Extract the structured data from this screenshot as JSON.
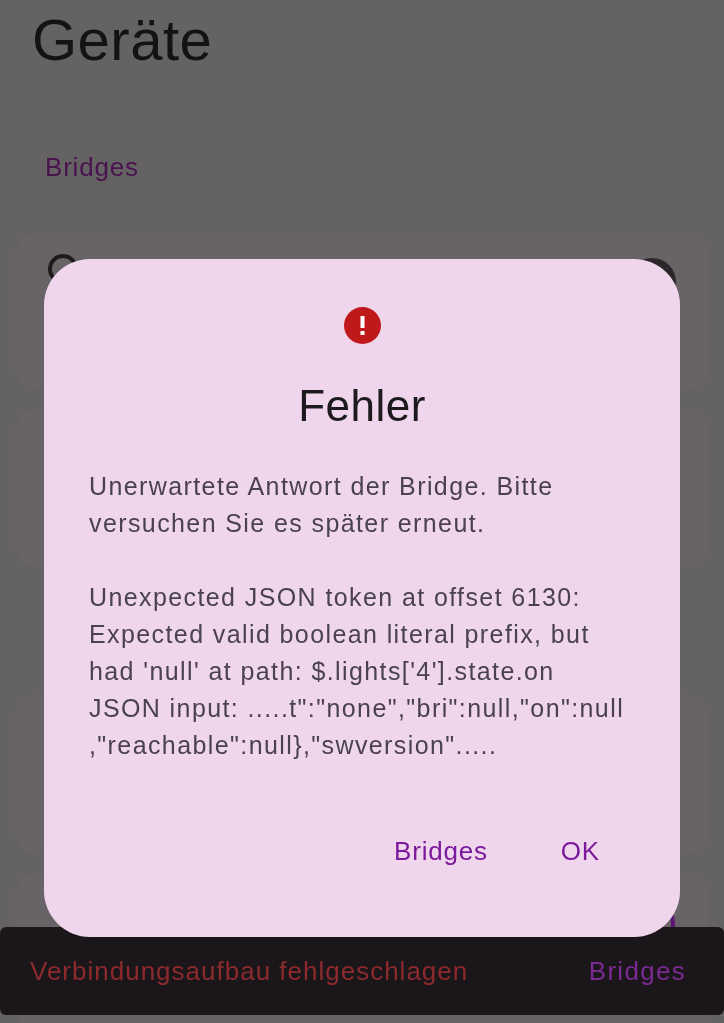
{
  "screen": {
    "title": "Geräte",
    "section_label": "Bridges"
  },
  "dialog": {
    "title": "Fehler",
    "message": [
      "Unerwartete Antwort der Bridge. Bitte versuchen Sie es später erneut.",
      "Unexpected JSON token at offset 6130: Expected valid boolean literal prefix, but had 'null' at path: $.lights['4'].state.on\nJSON input: .....t\":\"none\",\"bri\":null,\"on\":null\n,\"reachable\":null},\"swversion\"....."
    ],
    "actions": [
      {
        "label": "Bridges"
      },
      {
        "label": "OK"
      }
    ]
  },
  "snackbar": {
    "message": "Verbindungsaufbau fehlgeschlagen",
    "action": "Bridges"
  }
}
